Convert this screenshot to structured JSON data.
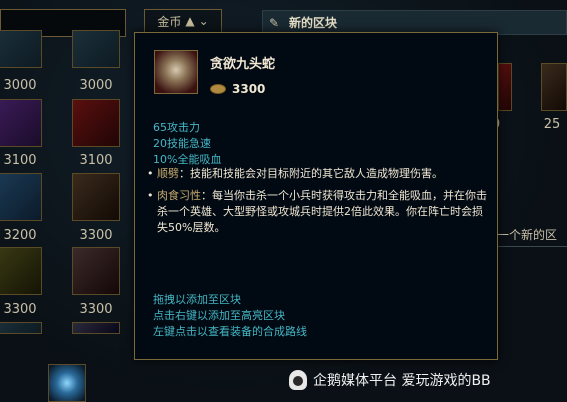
{
  "sort_button": {
    "label": "金币",
    "arrow": "▲",
    "caret": "⌄"
  },
  "blocks_header": {
    "title": "新的区块",
    "icon": "edit-icon"
  },
  "grid_prices": [
    "3000",
    "3000",
    "3100",
    "3100",
    "3200",
    "3300",
    "3300",
    "3300"
  ],
  "right_prices": [
    "0",
    "25"
  ],
  "tooltip": {
    "name": "贪欲九头蛇",
    "cost": "3300",
    "stats": [
      "65攻击力",
      "20技能急速",
      "10%全能吸血"
    ],
    "passives": [
      {
        "name": "顺劈",
        "sep": "：",
        "text": "技能和技能会对目标附近的其它敌人造成物理伤害。"
      },
      {
        "name": "肉食习性",
        "sep": "：",
        "text": "每当你击杀一个小兵时获得攻击力和全能吸血，并在你击杀一个英雄、大型野怪或攻城兵时提供2倍此效果。你在阵亡时会损失50%层数。"
      }
    ],
    "hints": [
      "拖拽以添加至区块",
      "点击右键以添加至高亮区块",
      "左键点击以查看装备的合成路线"
    ]
  },
  "right_partial_text": "一个新的区",
  "watermark": "企鹅媒体平台 爱玩游戏的BB",
  "colors": {
    "accent_gold": "#7a6a3a",
    "stat_cyan": "#45b6c4",
    "passive_gold": "#c8aa6e"
  }
}
